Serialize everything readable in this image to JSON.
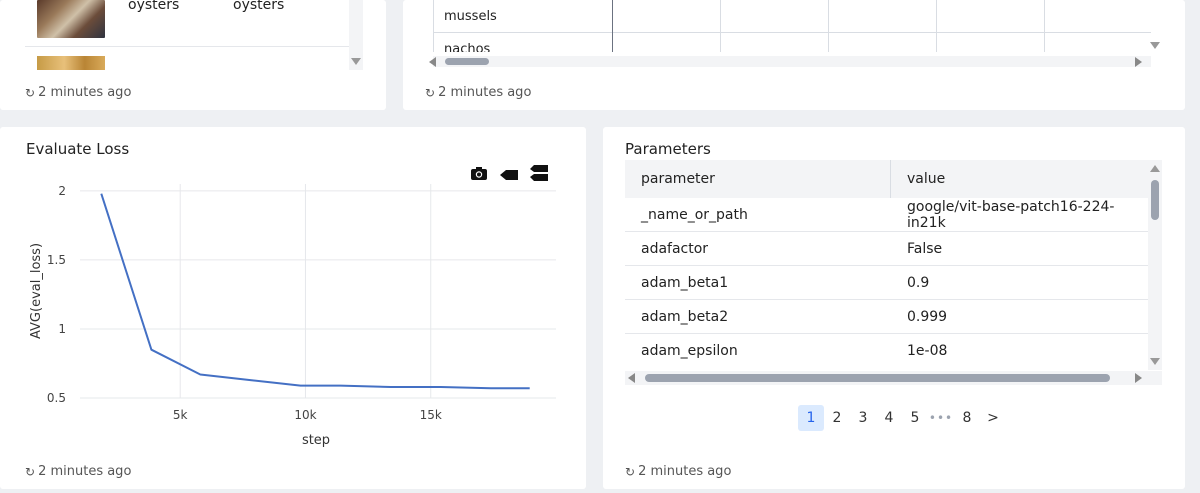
{
  "top_left": {
    "cell_a": "oysters",
    "cell_b": "oysters",
    "refresh_text": "2 minutes ago"
  },
  "top_right": {
    "rows": [
      "mussels",
      "nachos"
    ],
    "refresh_text": "2 minutes ago"
  },
  "loss_chart": {
    "title": "Evaluate Loss",
    "refresh_text": "2 minutes ago",
    "modebar": {
      "camera_icon": "camera-icon",
      "pan_icon": "pan-icon",
      "compare_icon": "compare-icon"
    }
  },
  "chart_data": {
    "type": "line",
    "title": "Evaluate Loss",
    "xlabel": "step",
    "ylabel": "AVG(eval_loss)",
    "xlim": [
      1000,
      20000
    ],
    "ylim": [
      0.5,
      2.05
    ],
    "x_ticks": [
      "5k",
      "10k",
      "15k"
    ],
    "y_ticks": [
      "2",
      "1.5",
      "1",
      "0.5"
    ],
    "grid": true,
    "line_color": "#4470c4",
    "series": [
      {
        "x": [
          1850,
          3850,
          5800,
          7800,
          9800,
          11400,
          13400,
          15400,
          17400,
          18950
        ],
        "y": [
          1.98,
          0.85,
          0.67,
          0.63,
          0.59,
          0.59,
          0.58,
          0.58,
          0.57,
          0.57
        ]
      }
    ]
  },
  "params": {
    "title": "Parameters",
    "headers": {
      "parameter": "parameter",
      "value": "value"
    },
    "rows": [
      {
        "parameter": "_name_or_path",
        "value": "google/vit-base-patch16-224-in21k"
      },
      {
        "parameter": "adafactor",
        "value": "False"
      },
      {
        "parameter": "adam_beta1",
        "value": "0.9"
      },
      {
        "parameter": "adam_beta2",
        "value": "0.999"
      },
      {
        "parameter": "adam_epsilon",
        "value": "1e-08"
      }
    ],
    "pages": [
      "1",
      "2",
      "3",
      "4",
      "5",
      "•••",
      "8",
      ">"
    ],
    "active_page": "1",
    "refresh_text": "2 minutes ago"
  }
}
